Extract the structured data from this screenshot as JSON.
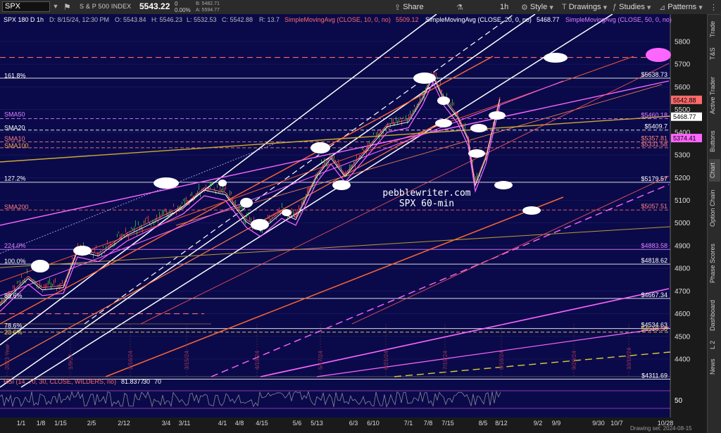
{
  "toolbar": {
    "symbol": "SPX",
    "name": "S & P 500 INDEX",
    "last": "5543.22",
    "change_line1": "0",
    "change_line2": "0.00%",
    "bid": "B: 5482.71",
    "ask": "A: 5594.77",
    "share": "Share",
    "timeframe": "1h",
    "style": "Style",
    "drawings": "Drawings",
    "studies": "Studies",
    "patterns": "Patterns"
  },
  "chart_header": {
    "title": "SPX 180 D 1h",
    "date": "D: 8/15/24, 12:30 PM",
    "open": "O: 5543.84",
    "high": "H: 5546.23",
    "low": "L: 5532.53",
    "close": "C: 5542.88",
    "range": "R: 13.7",
    "sma10_label": "SimpleMovingAvg (CLOSE, 10, 0, no)",
    "sma10_val": "5509.12",
    "sma20_label": "SimpleMovingAvg (CLOSE, 20, 0, no)",
    "sma20_val": "5468.77",
    "sma50_label": "SimpleMovingAvg (CLOSE, 50, 0, no)"
  },
  "price_axis": [
    "5800",
    "5700",
    "5600",
    "5500",
    "5400",
    "5300",
    "5200",
    "5100",
    "5000",
    "4900",
    "4800",
    "4700",
    "4600",
    "4500",
    "4400"
  ],
  "level_labels": [
    {
      "text": "$5638.73",
      "color": "#ffffff"
    },
    {
      "text": "$5460.18",
      "color": "#e080ff"
    },
    {
      "text": "$5409.7",
      "color": "#ffffff"
    },
    {
      "text": "$5357.81",
      "color": "#ff8080"
    },
    {
      "text": "$5331.58",
      "color": "#ff8080"
    },
    {
      "text": "$5179.57",
      "color": "#ffffff"
    },
    {
      "text": "$5057.51",
      "color": "#ff8080"
    },
    {
      "text": "$4883.58",
      "color": "#e080ff"
    },
    {
      "text": "$4818.62",
      "color": "#ffffff"
    },
    {
      "text": "$4667.34",
      "color": "#ffffff"
    },
    {
      "text": "$4534.63",
      "color": "#ffffff"
    },
    {
      "text": "$4518.58",
      "color": "#ffdd55"
    },
    {
      "text": "$4311.69",
      "color": "#ffffff"
    }
  ],
  "price_tags": [
    {
      "text": "5542.88",
      "bg": "#ff6b6b",
      "fg": "#000"
    },
    {
      "text": "5468.77",
      "bg": "#ffffff",
      "fg": "#000"
    },
    {
      "text": "5374.41",
      "bg": "#ff66ff",
      "fg": "#000"
    }
  ],
  "left_labels": [
    {
      "text": "161.8%",
      "color": "#ffffff"
    },
    {
      "text": "SMA50",
      "color": "#e080ff"
    },
    {
      "text": "SMA20",
      "color": "#ffffff"
    },
    {
      "text": "SMA10",
      "color": "#ff8080"
    },
    {
      "text": "SMA100",
      "color": "#ffaa55"
    },
    {
      "text": "127.2%",
      "color": "#ffffff"
    },
    {
      "text": "SMA200",
      "color": "#ff8080"
    },
    {
      "text": "224.0%",
      "color": "#e080ff"
    },
    {
      "text": "100.0%",
      "color": "#ffffff"
    },
    {
      "text": "88.6%",
      "color": "#ffffff"
    },
    {
      "text": "78.6%",
      "color": "#ffffff"
    },
    {
      "text": "23.6%",
      "color": "#ffdd55"
    }
  ],
  "watermark_line1": "pebblewriter.com",
  "watermark_line2": "SPX 60-min",
  "date_markers": [
    "2023 Year",
    "1/9/24",
    "2/16/24",
    "3/15/24",
    "4/19/24",
    "5/17/24",
    "6/21/24",
    "7/19/24",
    "8/16/24",
    "9/20/24",
    "10/18/24"
  ],
  "rsi": {
    "label": "RSI (14, 70, 30, CLOSE, WILDERS, no)",
    "value": "81.8377",
    "ob": "30",
    "os": "70",
    "axis": "50"
  },
  "time_axis": [
    "1/1",
    "1/8",
    "1/15",
    "2/5",
    "2/12",
    "3/4",
    "3/11",
    "4/1",
    "4/8",
    "4/15",
    "5/6",
    "5/13",
    "6/3",
    "6/10",
    "7/1",
    "7/8",
    "7/15",
    "8/5",
    "8/12",
    "9/2",
    "9/9",
    "9/30",
    "10/7",
    "10/28"
  ],
  "footer_note": "Drawing set: 2024-08-15",
  "sidebar": [
    "Trade",
    "T&S",
    "Active Trader",
    "Buttons",
    "Chart",
    "Option Chain",
    "Phase Scores",
    "Dashboard",
    "L 2",
    "News"
  ],
  "colors": {
    "chart_bg": "#0a0a4a",
    "candle_up": "#33cc33",
    "candle_down": "#ff4444",
    "fib_line": "#ffffff",
    "sma_pink": "#ff66ff",
    "channel_white": "#ffffff",
    "trend_orange": "#ff6633",
    "trend_yellow": "#ccaa33"
  }
}
